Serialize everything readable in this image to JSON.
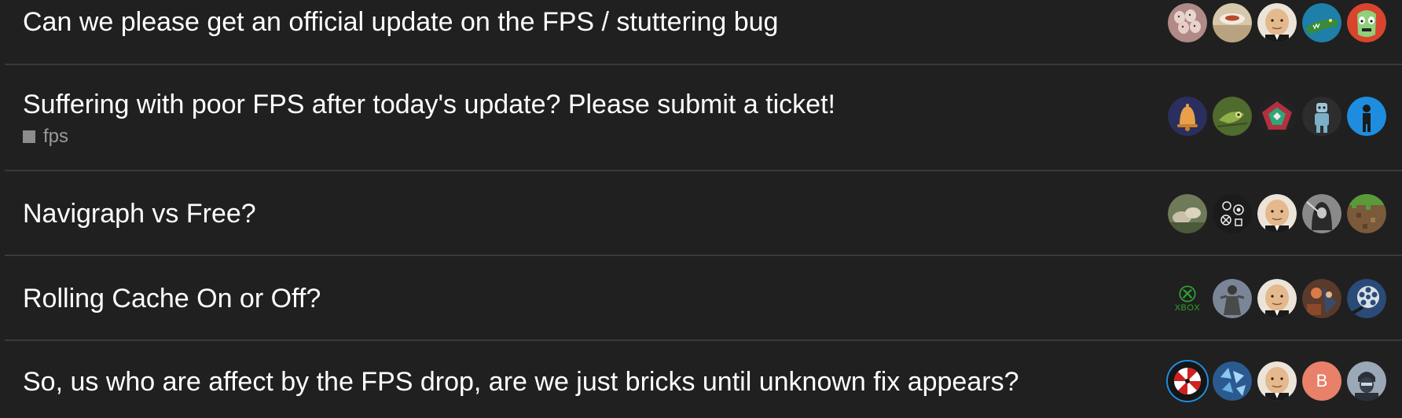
{
  "topics": [
    {
      "title": "Can we please get an official update on the FPS / stuttering bug",
      "tag": null,
      "posters": [
        {
          "icon": "eggs-avatar-icon",
          "color": "#c9a9a2"
        },
        {
          "icon": "plate-avatar-icon",
          "color": "#c8b9a0"
        },
        {
          "icon": "bald-man-avatar-icon",
          "color": "#d8b58f"
        },
        {
          "icon": "crocodile-avatar-icon",
          "color": "#1f8a7a"
        },
        {
          "icon": "luchador-mask-avatar-icon",
          "color": "#d9442e"
        }
      ]
    },
    {
      "title": "Suffering with poor FPS after today's update? Please submit a ticket!",
      "tag": "fps",
      "posters": [
        {
          "icon": "bell-avatar-icon",
          "color": "#2a2f5e"
        },
        {
          "icon": "chameleon-avatar-icon",
          "color": "#4f6b2d"
        },
        {
          "icon": "geometric-avatar-icon",
          "color": "#b3303f"
        },
        {
          "icon": "robot-avatar-icon",
          "color": "#2d2d2d"
        },
        {
          "icon": "figure-avatar-icon",
          "color": "#1e8de0"
        }
      ]
    },
    {
      "title": "Navigraph vs Free?",
      "tag": null,
      "posters": [
        {
          "icon": "rocks-avatar-icon",
          "color": "#8a8a70"
        },
        {
          "icon": "controller-buttons-avatar-icon",
          "color": "#1b1b1b"
        },
        {
          "icon": "bald-man-avatar-icon",
          "color": "#d8b58f"
        },
        {
          "icon": "hooded-figure-avatar-icon",
          "color": "#5a5a5a"
        },
        {
          "icon": "minecraft-dirt-avatar-icon",
          "color": "#7a5a3a"
        }
      ]
    },
    {
      "title": "Rolling Cache On or Off?",
      "tag": null,
      "posters": [
        {
          "icon": "xbox-logo-avatar-icon",
          "color": "#2fa02f",
          "text": "XBOX"
        },
        {
          "icon": "statue-avatar-icon",
          "color": "#8a96a8"
        },
        {
          "icon": "bald-man-avatar-icon",
          "color": "#d8b58f"
        },
        {
          "icon": "action-scene-avatar-icon",
          "color": "#6a4030"
        },
        {
          "icon": "film-reel-avatar-icon",
          "color": "#3a6aa0"
        }
      ]
    },
    {
      "title": "So, us who are affect by the FPS drop, are we just bricks until unknown fix appears?",
      "tag": null,
      "posters": [
        {
          "icon": "umbrella-logo-avatar-icon",
          "color": "#1b1b1b"
        },
        {
          "icon": "crystal-avatar-icon",
          "color": "#3a7ab8"
        },
        {
          "icon": "bald-man-avatar-icon",
          "color": "#d8b58f"
        },
        {
          "icon": "letter-b-avatar-icon",
          "color": "#e8806a",
          "text": "B"
        },
        {
          "icon": "soldier-avatar-icon",
          "color": "#9aa8b8"
        }
      ]
    }
  ]
}
